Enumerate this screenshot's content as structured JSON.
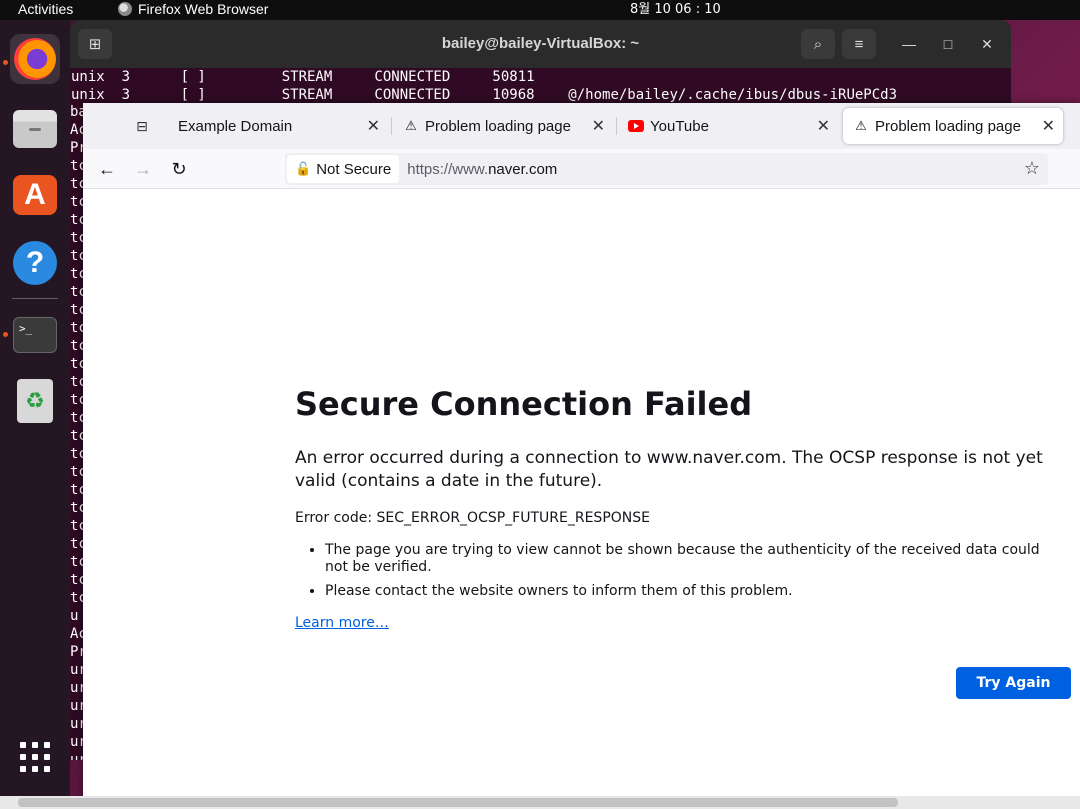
{
  "topbar": {
    "activities": "Activities",
    "app_name": "Firefox Web Browser",
    "clock": "8월 10  06 : 10"
  },
  "dock": {
    "items": [
      {
        "name": "firefox",
        "icon": "firefox-icon"
      },
      {
        "name": "files",
        "icon": "files-icon"
      },
      {
        "name": "app-center",
        "icon": "app-store-icon"
      },
      {
        "name": "help",
        "icon": "help-icon"
      },
      {
        "name": "terminal",
        "icon": "terminal-icon"
      },
      {
        "name": "trash",
        "icon": "trash-icon"
      },
      {
        "name": "show-apps",
        "icon": "app-grid-icon"
      }
    ]
  },
  "terminal": {
    "title": "bailey@bailey-VirtualBox: ~",
    "lines": [
      "unix  3      [ ]         STREAM     CONNECTED     50811",
      "unix  3      [ ]         STREAM     CONNECTED     10968    @/home/bailey/.cache/ibus/dbus-iRUePCd3"
    ],
    "side_chars": [
      "ba",
      "Ac",
      "Pr",
      "tc",
      "tc",
      "tc",
      "tc",
      "tc",
      "tc",
      "tc",
      "tc",
      "tc",
      "tc",
      "tc",
      "tc",
      "tc",
      "tc",
      "tc",
      "tc",
      "tc",
      "tc",
      "tc",
      "tc",
      "tc",
      "tc",
      "tc",
      "tc",
      "tc",
      "u",
      "Ac",
      "Pr",
      "ur",
      "ur",
      "ur",
      "ur",
      "ur",
      "ur",
      "ur"
    ]
  },
  "browser": {
    "tabs": [
      {
        "label": "Example Domain",
        "icon": "none"
      },
      {
        "label": "Problem loading page",
        "icon": "warning-icon"
      },
      {
        "label": "YouTube",
        "icon": "youtube-icon"
      },
      {
        "label": "Problem loading page",
        "icon": "warning-icon",
        "selected": true
      }
    ],
    "security_label": "Not Secure",
    "url_prefix": "https://www.",
    "url_domain": "naver.com"
  },
  "error_page": {
    "title": "Secure Connection Failed",
    "description": "An error occurred during a connection to www.naver.com. The OCSP response is not yet valid (contains a date in the future).",
    "error_code": "Error code: SEC_ERROR_OCSP_FUTURE_RESPONSE",
    "bullets": [
      "The page you are trying to view cannot be shown because the authenticity of the received data could not be verified.",
      "Please contact the website owners to inform them of this problem."
    ],
    "learn_more": "Learn more…",
    "try_again": "Try Again"
  }
}
